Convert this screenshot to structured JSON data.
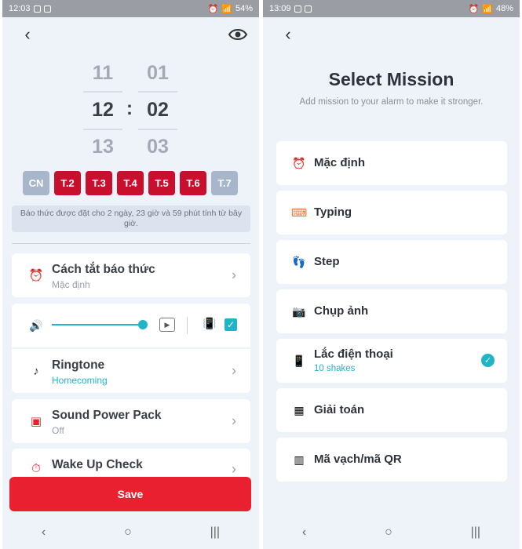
{
  "left": {
    "status": {
      "time": "12:03",
      "battery": "54%"
    },
    "picker": {
      "hours": [
        "11",
        "12",
        "13"
      ],
      "minutes": [
        "01",
        "02",
        "03"
      ],
      "separator": ":"
    },
    "days": [
      {
        "label": "CN",
        "on": false
      },
      {
        "label": "T.2",
        "on": true
      },
      {
        "label": "T.3",
        "on": true
      },
      {
        "label": "T.4",
        "on": true
      },
      {
        "label": "T.5",
        "on": true
      },
      {
        "label": "T.6",
        "on": true
      },
      {
        "label": "T.7",
        "on": false
      }
    ],
    "info_line1": "Báo thức được đặt cho 2 ngày, 23 giờ và 59 phút tính từ bây",
    "info_line2": "giờ.",
    "dismiss": {
      "title": "Cách tắt báo thức",
      "value": "Mặc định"
    },
    "volume": {
      "level": 0.9,
      "vibrate_checked": true
    },
    "ringtone": {
      "title": "Ringtone",
      "value": "Homecoming"
    },
    "sound_pack": {
      "title": "Sound Power Pack",
      "value": "Off"
    },
    "wake_check": {
      "title": "Wake Up Check"
    },
    "save_label": "Save",
    "colors": {
      "accent": "#1fb5c6",
      "day_on": "#c8102e",
      "save": "#e8202f"
    }
  },
  "right": {
    "status": {
      "time": "13:09",
      "battery": "48%"
    },
    "title": "Select Mission",
    "subtitle": "Add mission to your alarm to make it stronger.",
    "missions": [
      {
        "label": "Mặc định",
        "icon": "alarm-icon"
      },
      {
        "label": "Typing",
        "icon": "keyboard-icon"
      },
      {
        "label": "Step",
        "icon": "footprint-icon"
      },
      {
        "label": "Chụp ảnh",
        "icon": "camera-icon"
      },
      {
        "label": "Lắc điện thoại",
        "sub": "10 shakes",
        "icon": "shake-phone-icon",
        "selected": true
      },
      {
        "label": "Giải toán",
        "icon": "calculator-icon"
      },
      {
        "label": "Mã vạch/mã QR",
        "icon": "barcode-icon"
      }
    ]
  }
}
